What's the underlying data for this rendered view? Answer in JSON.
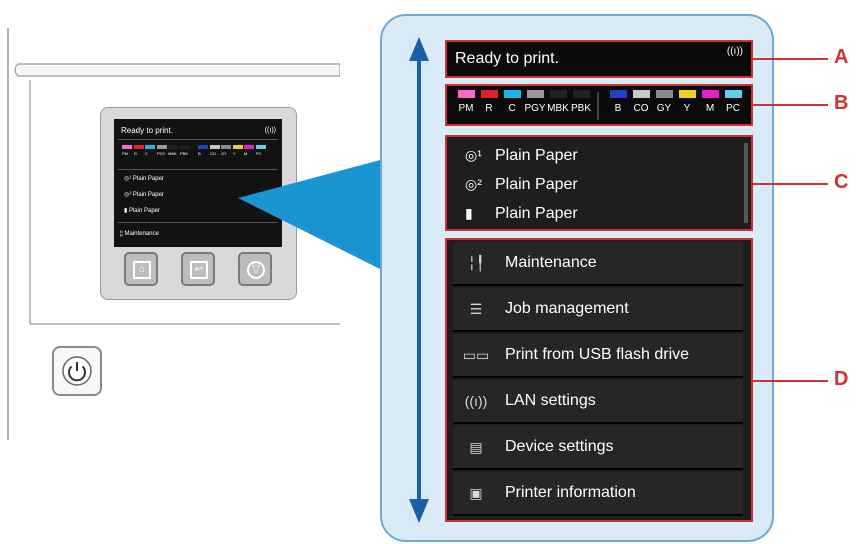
{
  "status": {
    "text": "Ready to print.",
    "wireless_icon": "wireless-icon"
  },
  "inks": [
    {
      "label": "PM",
      "color": "#ff66cc"
    },
    {
      "label": "R",
      "color": "#e0202a"
    },
    {
      "label": "C",
      "color": "#19b8e6"
    },
    {
      "label": "PGY",
      "color": "#9a9a9a"
    },
    {
      "label": "MBK",
      "color": "#202020"
    },
    {
      "label": "PBK",
      "color": "#202020"
    },
    {
      "label": "B",
      "color": "#2040c8"
    },
    {
      "label": "CO",
      "color": "#c8c8c8"
    },
    {
      "label": "GY",
      "color": "#8a8a8a"
    },
    {
      "label": "Y",
      "color": "#f0d020"
    },
    {
      "label": "M",
      "color": "#e020c8"
    },
    {
      "label": "PC",
      "color": "#60d0e8"
    }
  ],
  "paper": [
    {
      "icon": "roll-1-icon",
      "label": "Plain Paper"
    },
    {
      "icon": "roll-2-icon",
      "label": "Plain Paper"
    },
    {
      "icon": "cut-sheet-icon",
      "label": "Plain Paper"
    }
  ],
  "menu": [
    {
      "icon": "maintenance-icon",
      "label": "Maintenance"
    },
    {
      "icon": "job-management-icon",
      "label": "Job management"
    },
    {
      "icon": "usb-drive-icon",
      "label": "Print from USB flash drive"
    },
    {
      "icon": "lan-icon",
      "label": "LAN settings"
    },
    {
      "icon": "device-settings-icon",
      "label": "Device settings"
    },
    {
      "icon": "printer-information-icon",
      "label": "Printer information"
    }
  ],
  "mini": {
    "status": "Ready to print.",
    "paper": [
      "Plain Paper",
      "Plain Paper",
      "Plain Paper"
    ],
    "menu_first": "Maintenance"
  },
  "callouts": {
    "a": "A",
    "b": "B",
    "c": "C",
    "d": "D"
  },
  "colors": {
    "callout": "#d03030",
    "panel_bg": "#d8ebf6",
    "panel_border": "#6fa8d8",
    "arrow": "#1d5fa6",
    "beam": "#1a95d2"
  }
}
